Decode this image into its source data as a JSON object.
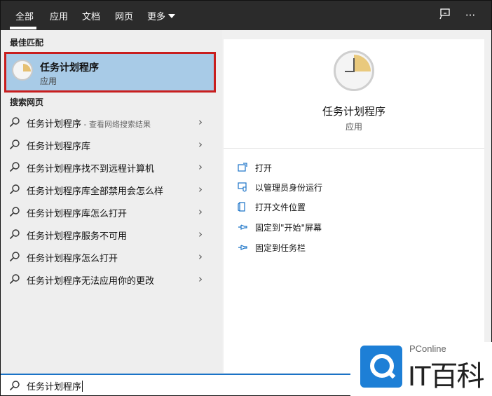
{
  "tabs": [
    "全部",
    "应用",
    "文档",
    "网页",
    "更多"
  ],
  "topbar_icons": [
    "feedback-icon",
    "more-icon"
  ],
  "best_match": {
    "section_label": "最佳匹配",
    "title": "任务计划程序",
    "subtitle": "应用"
  },
  "web_search": {
    "section_label": "搜索网页",
    "items": [
      {
        "text": "任务计划程序",
        "note": " - 查看网络搜索结果"
      },
      {
        "text": "任务计划程序库",
        "note": ""
      },
      {
        "text": "任务计划程序找不到远程计算机",
        "note": ""
      },
      {
        "text": "任务计划程序库全部禁用会怎么样",
        "note": ""
      },
      {
        "text": "任务计划程序库怎么打开",
        "note": ""
      },
      {
        "text": "任务计划程序服务不可用",
        "note": ""
      },
      {
        "text": "任务计划程序怎么打开",
        "note": ""
      },
      {
        "text": "任务计划程序无法应用你的更改",
        "note": ""
      }
    ]
  },
  "detail": {
    "title": "任务计划程序",
    "subtitle": "应用",
    "actions": [
      {
        "label": "打开",
        "icon": "open-icon"
      },
      {
        "label": "以管理员身份运行",
        "icon": "run-as-admin-icon"
      },
      {
        "label": "打开文件位置",
        "icon": "file-location-icon"
      },
      {
        "label": "固定到\"开始\"屏幕",
        "icon": "pin-icon"
      },
      {
        "label": "固定到任务栏",
        "icon": "pin-icon"
      }
    ]
  },
  "search": {
    "value": "任务计划程序"
  },
  "watermark": {
    "line1": "PConline",
    "line2": "IT百科"
  },
  "colors": {
    "topbar": "#2b2b2b",
    "selected": "#a8cbe7",
    "highlight_border": "#c81e1e",
    "accent": "#1a73c7"
  }
}
